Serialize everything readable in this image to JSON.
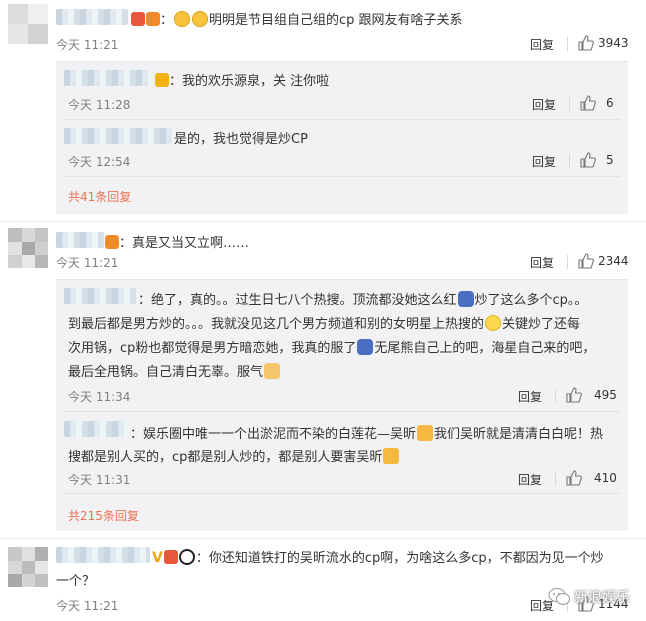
{
  "reply_label": "回复",
  "comments": [
    {
      "text": "明明是节目组自己组的cp 跟网友有啥子关系",
      "time": "今天 11:21",
      "likes": "3943",
      "replies": [
        {
          "text": "：我的欢乐源泉，关 注你啦",
          "time": "今天 11:28",
          "likes": "6"
        },
        {
          "text": "是的，我也觉得是炒CP",
          "time": "今天 12:54",
          "likes": "5"
        }
      ],
      "more": "共41条回复"
    },
    {
      "text": "：真是又当又立啊……",
      "time": "今天 11:21",
      "likes": "2344",
      "replies": [
        {
          "lines": [
            "：绝了，真的。。过生日七八个热搜。顶流都没她这么红",
            "炒了这么多个cp。。",
            "到最后都是男方炒的。。。我就没见这几个男方频道和别的女明星上热搜的",
            "关键炒了还每",
            "次用锅，cp粉也都觉得是男方暗恋她，我真的服了",
            "无尾熊自己上的吧，海星自己来的吧，",
            "最后全甩锅。自己清白无辜。服气"
          ],
          "time": "今天 11:34",
          "likes": "495"
        },
        {
          "lines": [
            "：娱乐圈中唯一一个出淤泥而不染的白莲花—吴昕",
            "我们吴昕就是清清白白呢！热",
            "搜都是别人买的，cp都是别人炒的，都是别人要害吴昕"
          ],
          "time": "今天 11:31",
          "likes": "410"
        }
      ],
      "more": "共215条回复"
    },
    {
      "lines": [
        "：你还知道铁打的吴昕流水的cp啊，为啥这么多cp，不都因为见一个炒",
        "一个？"
      ],
      "time": "今天 11:21",
      "likes": "1144"
    }
  ],
  "watermark": "新浪娱乐",
  "colors": {
    "link": "#eb7350",
    "meta": "#808080",
    "sub_bg": "#f2f2f5"
  }
}
